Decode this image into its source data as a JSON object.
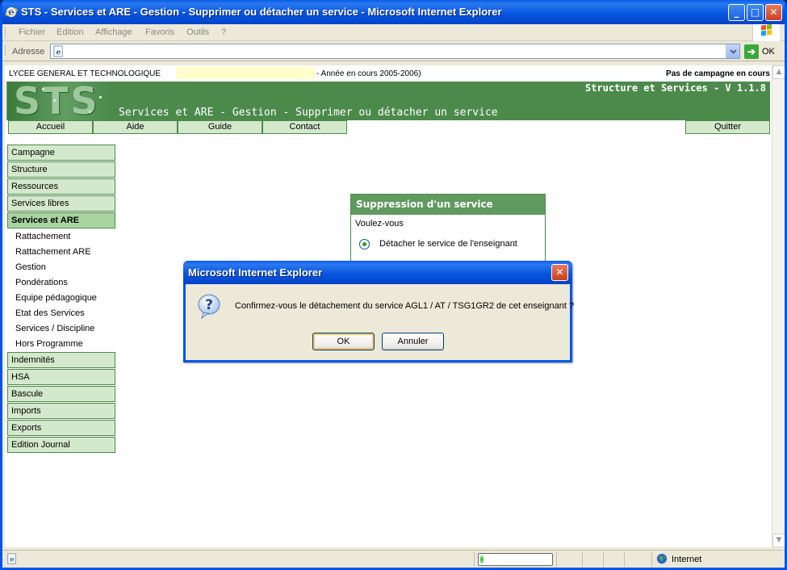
{
  "window": {
    "title": "STS - Services et ARE - Gestion - Supprimer ou détacher un service - Microsoft Internet Explorer",
    "minimize_glyph": "_",
    "maximize_glyph": "□",
    "close_glyph": "✕"
  },
  "menubar": {
    "items": [
      "Fichier",
      "Edition",
      "Affichage",
      "Favoris",
      "Outils",
      "?"
    ]
  },
  "addressbar": {
    "label": "Adresse",
    "value": "",
    "go_arrow": "➔",
    "go_label": "OK"
  },
  "page": {
    "infobar": {
      "school": "LYCEE GENERAL ET TECHNOLOGIQUE",
      "year": "- Année en cours 2005-2006)",
      "campaign": "Pas de campagne en cours"
    },
    "banner": {
      "logo_text": "STS",
      "app_version": "Structure et Services - V 1.1.8",
      "page_title": "Services et ARE - Gestion - Supprimer ou détacher un service"
    },
    "topnav": [
      "Accueil",
      "Aide",
      "Guide",
      "Contact",
      "Quitter"
    ],
    "sidebar": {
      "top_items": [
        "Campagne",
        "Structure",
        "Ressources",
        "Services libres",
        "Services et ARE"
      ],
      "sub_items": [
        "Rattachement",
        "Rattachement ARE",
        "Gestion",
        "Pondérations",
        "Equipe pédagogique",
        "Etat des Services",
        "Services / Discipline",
        "Hors Programme"
      ],
      "bottom_items": [
        "Indemnités",
        "HSA",
        "Bascule",
        "Imports",
        "Exports",
        "Edition Journal"
      ]
    },
    "panel": {
      "title": "Suppression d'un service",
      "question": "Voulez-vous",
      "option": "Détacher le service de l'enseignant"
    }
  },
  "dialog": {
    "title": "Microsoft Internet Explorer",
    "icon": "question-icon",
    "message": "Confirmez-vous le détachement du service AGL1 / AT / TSG1GR2 de cet enseignant ?",
    "ok_label": "OK",
    "cancel_label": "Annuler",
    "close_glyph": "✕"
  },
  "statusbar": {
    "progress": 0.05,
    "zone": "Internet"
  },
  "scrollbar": {
    "up_glyph": "▲",
    "down_glyph": "▼"
  },
  "colors": {
    "xp_blue": "#0055e5",
    "sts_green": "#4c8a4c",
    "nav_green": "#d4e8cc",
    "active_green": "#a8d4a0"
  }
}
